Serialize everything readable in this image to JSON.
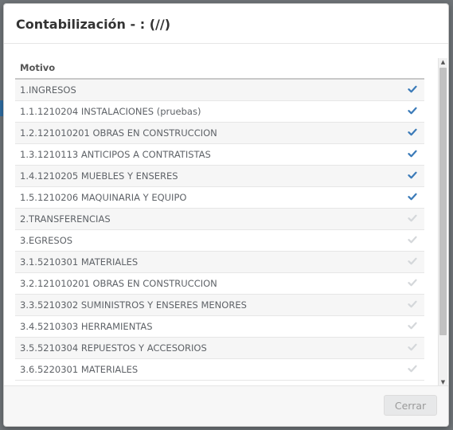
{
  "modal": {
    "title": "Contabilización - : (//)",
    "column_header": "Motivo",
    "close_label": "Cerrar"
  },
  "rows": [
    {
      "label": "1.INGRESOS",
      "checked": true
    },
    {
      "label": "1.1.1210204 INSTALACIONES (pruebas)",
      "checked": true
    },
    {
      "label": "1.2.121010201 OBRAS EN CONSTRUCCION",
      "checked": true
    },
    {
      "label": "1.3.1210113 ANTICIPOS A CONTRATISTAS",
      "checked": true
    },
    {
      "label": "1.4.1210205 MUEBLES Y ENSERES",
      "checked": true
    },
    {
      "label": "1.5.1210206 MAQUINARIA Y EQUIPO",
      "checked": true
    },
    {
      "label": "2.TRANSFERENCIAS",
      "checked": false
    },
    {
      "label": "3.EGRESOS",
      "checked": false
    },
    {
      "label": "3.1.5210301 MATERIALES",
      "checked": false
    },
    {
      "label": "3.2.121010201 OBRAS EN CONSTRUCCION",
      "checked": false
    },
    {
      "label": "3.3.5210302 SUMINISTROS Y ENSERES MENORES",
      "checked": false
    },
    {
      "label": "3.4.5210303 HERRAMIENTAS",
      "checked": false
    },
    {
      "label": "3.5.5210304 REPUESTOS Y ACCESORIOS",
      "checked": false
    },
    {
      "label": "3.6.5220301 MATERIALES",
      "checked": false
    }
  ],
  "colors": {
    "checked": "#3a7ab8",
    "unchecked": "#d4d7da"
  },
  "icons": {
    "check": "check-icon",
    "scroll_up": "scroll-up-arrow-icon",
    "scroll_down": "scroll-down-arrow-icon"
  }
}
